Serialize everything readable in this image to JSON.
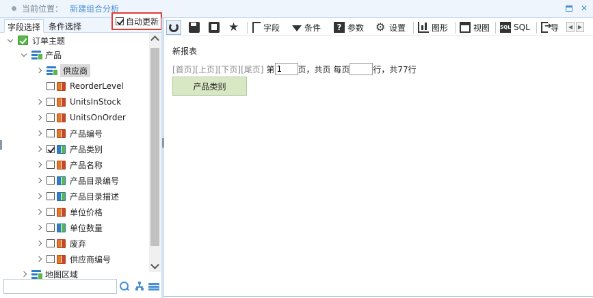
{
  "titlebar": {
    "location_label": "当前位置：",
    "page_title": "新建组合分析"
  },
  "left_panel": {
    "tabs": [
      {
        "label": "字段选择",
        "active": true
      },
      {
        "label": "条件选择",
        "active": false
      }
    ],
    "auto_update": {
      "label": "自动更新",
      "checked": true
    },
    "tree": {
      "root": {
        "label": "订单主题"
      },
      "group": {
        "label": "产品"
      },
      "items": [
        {
          "label": "供应商",
          "checkbox": false,
          "selected": true,
          "icon": "table-icon",
          "expandable": true
        },
        {
          "label": "ReorderLevel",
          "checkbox": true,
          "checked": false,
          "icon": "field-icon",
          "expandable": false
        },
        {
          "label": "UnitsInStock",
          "checkbox": true,
          "checked": false,
          "icon": "field-icon",
          "expandable": true
        },
        {
          "label": "UnitsOnOrder",
          "checkbox": true,
          "checked": false,
          "icon": "field-icon",
          "expandable": true
        },
        {
          "label": "产品编号",
          "checkbox": true,
          "checked": false,
          "icon": "field-icon",
          "expandable": true
        },
        {
          "label": "产品类别",
          "checkbox": true,
          "checked": true,
          "icon": "field-icon-blue",
          "expandable": true
        },
        {
          "label": "产品名称",
          "checkbox": true,
          "checked": false,
          "icon": "field-icon",
          "expandable": true
        },
        {
          "label": "产品目录编号",
          "checkbox": true,
          "checked": false,
          "icon": "field-icon-blue",
          "expandable": true
        },
        {
          "label": "产品目录描述",
          "checkbox": true,
          "checked": false,
          "icon": "field-icon-blue",
          "expandable": true
        },
        {
          "label": "单位价格",
          "checkbox": true,
          "checked": false,
          "icon": "field-icon",
          "expandable": true
        },
        {
          "label": "单位数量",
          "checkbox": true,
          "checked": false,
          "icon": "field-icon-blue",
          "expandable": true
        },
        {
          "label": "废弃",
          "checkbox": true,
          "checked": false,
          "icon": "field-icon",
          "expandable": true
        },
        {
          "label": "供应商编号",
          "checkbox": true,
          "checked": false,
          "icon": "field-icon",
          "expandable": true
        }
      ],
      "extra": {
        "label": "地图区域"
      }
    },
    "search": {
      "value": "",
      "placeholder": ""
    }
  },
  "toolbar": {
    "field": "字段",
    "condition": "条件",
    "param": "参数",
    "settings": "设置",
    "chart": "图形",
    "view": "视图",
    "sql": "SQL",
    "export": "导",
    "sql_icon_text": "SQL"
  },
  "main": {
    "report_title": "新报表",
    "pager": {
      "first": "[首页]",
      "prev": "[上页]",
      "next": "[下页]",
      "last": "[尾页]",
      "page_prefix": "第",
      "page_value": "1",
      "page_suffix": "页，共页 每页",
      "per_page_value": "",
      "total_text": "行，共77行"
    },
    "column_header": "产品类别"
  },
  "colors": {
    "accent": "#4a8fd1",
    "highlight_border": "#e53935",
    "header_green": "#d8e8c4"
  }
}
